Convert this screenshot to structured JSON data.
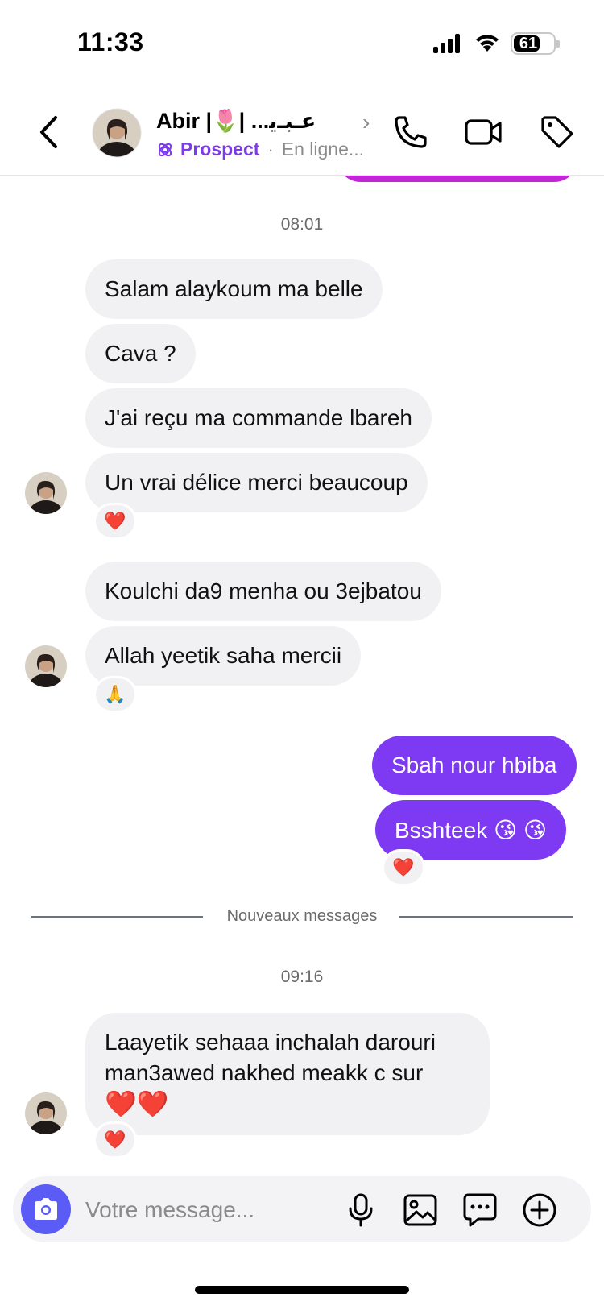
{
  "status_bar": {
    "time": "11:33",
    "battery": "61"
  },
  "header": {
    "name": "Abir |🌷| ...عـبـﯾ",
    "badge_label": "Prospect",
    "status_text": "En ligne...",
    "icons": [
      "chevron-left-icon",
      "phone-icon",
      "video-camera-icon",
      "tag-icon"
    ]
  },
  "messages": [
    {
      "type": "time",
      "text": "08:01"
    },
    {
      "sender": "contact",
      "text": "Salam alaykoum ma belle"
    },
    {
      "sender": "contact",
      "text": "Cava ?"
    },
    {
      "sender": "contact",
      "text": "J'ai reçu ma commande lbareh"
    },
    {
      "sender": "contact",
      "text": "Un vrai délice merci beaucoup",
      "reaction": "❤️"
    },
    {
      "sender": "contact",
      "text": "Koulchi da9 menha ou 3ejbatou"
    },
    {
      "sender": "contact",
      "text": "Allah yeetik saha mercii",
      "reaction": "🙏"
    },
    {
      "sender": "me",
      "text": "Sbah nour hbiba"
    },
    {
      "sender": "me",
      "text": "Bsshteek 😘 😘",
      "reaction": "❤️"
    },
    {
      "type": "divider",
      "text": "Nouveaux messages"
    },
    {
      "type": "time",
      "text": "09:16"
    },
    {
      "sender": "contact",
      "lines": [
        "Laayetik sehaaa inchalah darouri",
        "man3awed nakhed meakk c sur",
        "❤️❤️"
      ],
      "reaction": "❤️"
    }
  ],
  "composer": {
    "placeholder": "Votre message...",
    "icons": [
      "camera-icon",
      "microphone-icon",
      "image-icon",
      "chat-template-icon",
      "plus-circle-icon"
    ]
  },
  "colors": {
    "accent": "#7e3af2",
    "bubble_in": "#f1f1f3",
    "prospect": "#7c3aed",
    "camera_button": "#5b5cf6"
  }
}
